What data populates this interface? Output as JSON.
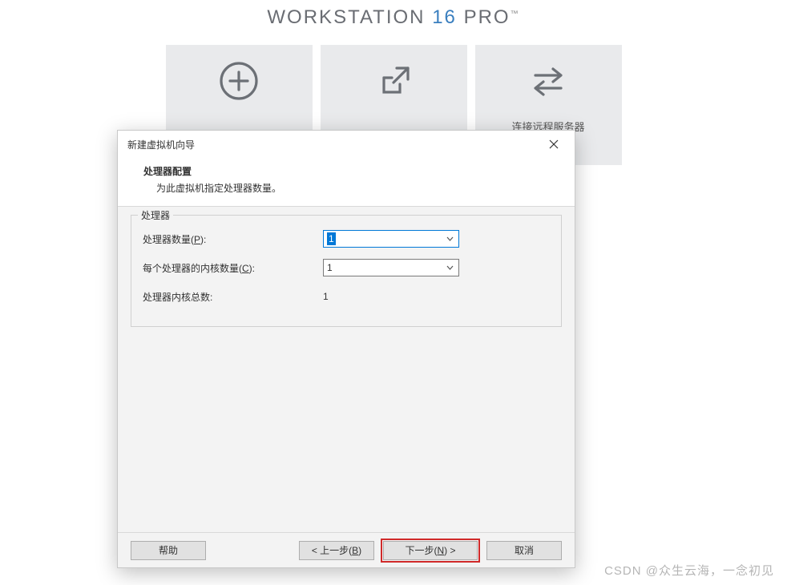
{
  "brand": {
    "word1": "WORKSTATION",
    "word2": "16",
    "word3": "PRO",
    "tm": "™"
  },
  "launcher": {
    "tile3_label": "连接远程服务器"
  },
  "dialog": {
    "title": "新建虚拟机向导",
    "heading": "处理器配置",
    "description": "为此虚拟机指定处理器数量。",
    "group_legend": "处理器",
    "rows": {
      "proc_count_label_pre": "处理器数量(",
      "proc_count_key": "P",
      "proc_count_label_post": "):",
      "proc_count_value": "1",
      "cores_label_pre": "每个处理器的内核数量(",
      "cores_key": "C",
      "cores_label_post": "):",
      "cores_value": "1",
      "total_label": "处理器内核总数:",
      "total_value": "1"
    },
    "buttons": {
      "help": "帮助",
      "back_pre": "< 上一步(",
      "back_key": "B",
      "back_post": ")",
      "next_pre": "下一步(",
      "next_key": "N",
      "next_post": ") >",
      "cancel": "取消"
    }
  },
  "watermark": "CSDN @众生云海，一念初见"
}
